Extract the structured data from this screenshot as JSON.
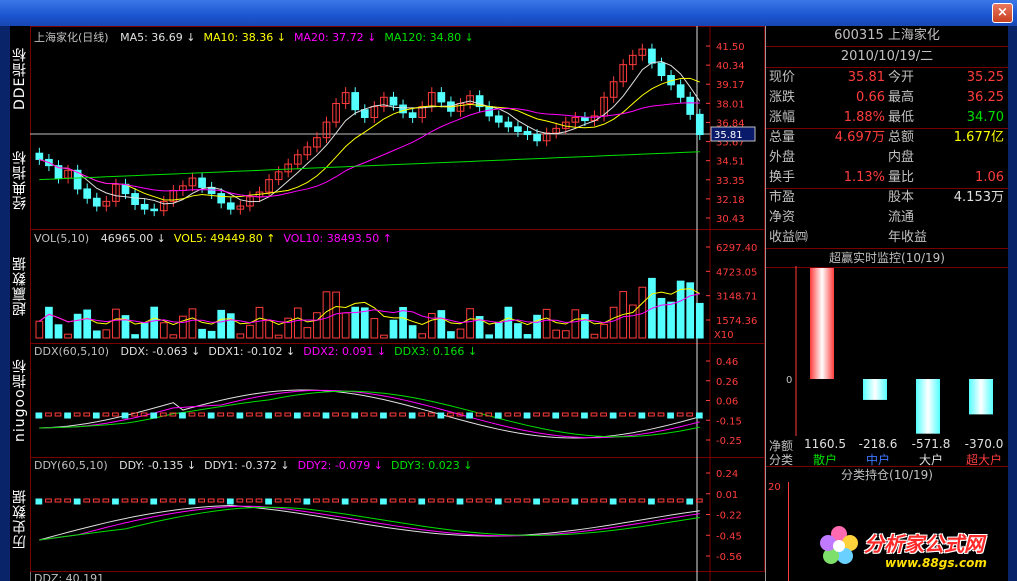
{
  "window": {
    "close_symbol": "×"
  },
  "tabs": [
    "DDE指标",
    "经典指标",
    "超赢数据",
    "niugoo指标",
    "历史数据"
  ],
  "panels": {
    "price": {
      "title": "上海家化(日线)",
      "indicators": [
        {
          "label": "MA5:",
          "value": "36.69",
          "arrow": "↓",
          "color": "#e0e0e0"
        },
        {
          "label": "MA10:",
          "value": "38.36",
          "arrow": "↓",
          "color": "#ffff00"
        },
        {
          "label": "MA20:",
          "value": "37.72",
          "arrow": "↓",
          "color": "#ff00ff"
        },
        {
          "label": "MA120:",
          "value": "34.80",
          "arrow": "↓",
          "color": "#00e000"
        }
      ],
      "axis": [
        "41.50",
        "40.34",
        "39.17",
        "38.01",
        "36.84",
        "35.67",
        "34.51",
        "33.35",
        "32.18",
        "30.43"
      ],
      "current_price": "35.81"
    },
    "volume": {
      "title": "VOL(5,10)",
      "indicators": [
        {
          "label": "",
          "value": "46965.00",
          "arrow": "↓",
          "color": "#e0e0e0"
        },
        {
          "label": "VOL5:",
          "value": "49449.80",
          "arrow": "↑",
          "color": "#ffff00"
        },
        {
          "label": "VOL10:",
          "value": "38493.50",
          "arrow": "↑",
          "color": "#ff00ff"
        }
      ],
      "axis": [
        "6297.40",
        "4723.05",
        "3148.71",
        "1574.36"
      ],
      "unit": "X10"
    },
    "ddx": {
      "title": "DDX(60,5,10)",
      "indicators": [
        {
          "label": "DDX:",
          "value": "-0.063",
          "arrow": "↓",
          "color": "#e0e0e0"
        },
        {
          "label": "DDX1:",
          "value": "-0.102",
          "arrow": "↓",
          "color": "#e0e0e0"
        },
        {
          "label": "DDX2:",
          "value": "0.091",
          "arrow": "↓",
          "color": "#ff00ff"
        },
        {
          "label": "DDX3:",
          "value": "0.166",
          "arrow": "↓",
          "color": "#00e000"
        }
      ],
      "axis": [
        "0.46",
        "0.26",
        "0.06",
        "-0.15",
        "-0.25"
      ]
    },
    "ddy": {
      "title": "DDY(60,5,10)",
      "indicators": [
        {
          "label": "DDY:",
          "value": "-0.135",
          "arrow": "↓",
          "color": "#e0e0e0"
        },
        {
          "label": "DDY1:",
          "value": "-0.372",
          "arrow": "↓",
          "color": "#e0e0e0"
        },
        {
          "label": "DDY2:",
          "value": "-0.079",
          "arrow": "↓",
          "color": "#ff00ff"
        },
        {
          "label": "DDY3:",
          "value": "0.023",
          "arrow": "↓",
          "color": "#00e000"
        }
      ],
      "axis": [
        "0.24",
        "0.01",
        "-0.22",
        "-0.45",
        "-0.56"
      ]
    },
    "ddz_partial": "DDZ: 40.191"
  },
  "quote": {
    "header": "600315 上海家化",
    "date": "2010/10/19/二",
    "rows": [
      [
        "现价",
        "35.81",
        "今开",
        "35.25"
      ],
      [
        "涨跌",
        "0.66",
        "最高",
        "36.25"
      ],
      [
        "涨幅",
        "1.88%",
        "最低",
        "34.70"
      ],
      [
        "总量",
        "4.697万",
        "总额",
        "1.677亿"
      ],
      [
        "外盘",
        "",
        "内盘",
        ""
      ],
      [
        "换手",
        "1.13%",
        "量比",
        "1.06"
      ],
      [
        "市盈",
        "",
        "股本",
        "4.153万"
      ],
      [
        "净资",
        "",
        "流通",
        ""
      ],
      [
        "收益㈣",
        "",
        "年收益",
        ""
      ]
    ],
    "monitor_title": "超赢实时监控(10/19)",
    "monitor_zero": "0",
    "net_label": "净额",
    "class_label": "分类",
    "net_values": [
      "1160.5",
      "-218.6",
      "-571.8",
      "-370.0"
    ],
    "categories": [
      {
        "name": "散户",
        "color": "#00e000"
      },
      {
        "name": "中户",
        "color": "#3c78ff"
      },
      {
        "name": "大户",
        "color": "#e0e0e0"
      },
      {
        "name": "超大户",
        "color": "#ff3c3c"
      }
    ],
    "holding_title": "分类持仓(10/19)",
    "holding_axis": "20"
  },
  "watermark": {
    "text": "分析家公式网",
    "url": "www.88gs.com"
  }
}
